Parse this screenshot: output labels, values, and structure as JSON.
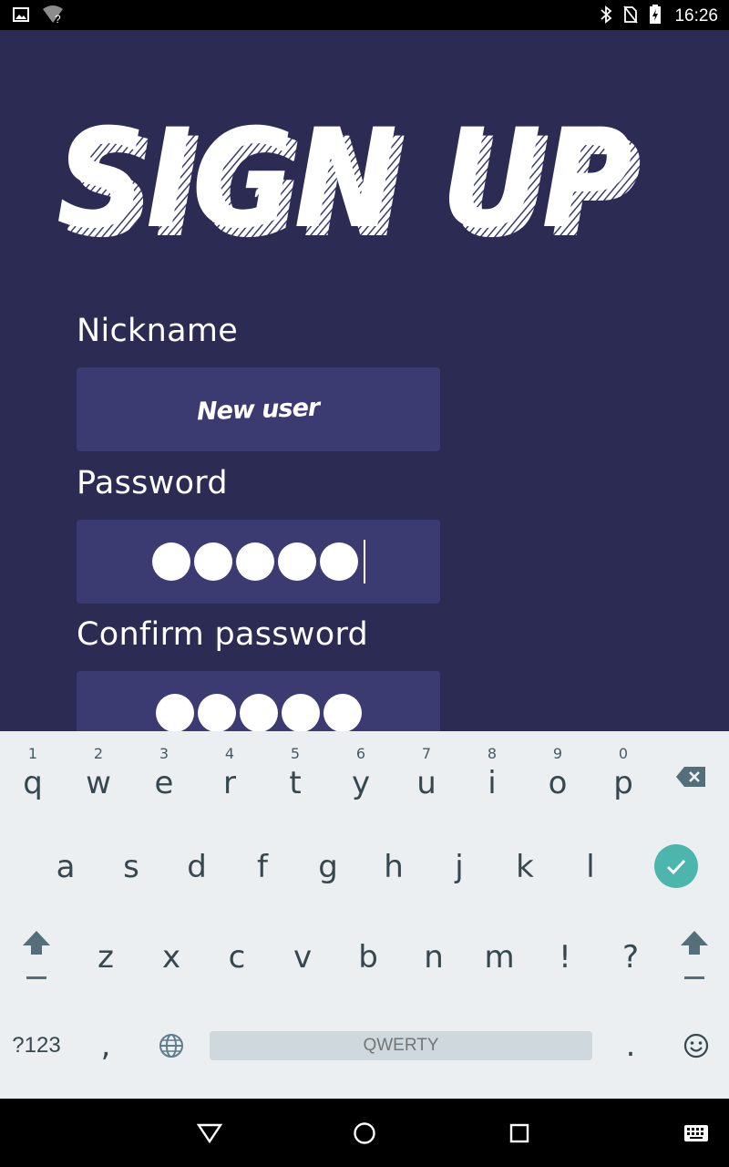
{
  "status_bar": {
    "time": "16:26",
    "left_icons": [
      "image-icon",
      "wifi-unknown-icon"
    ],
    "right_icons": [
      "bluetooth-icon",
      "no-sim-icon",
      "battery-charging-icon"
    ]
  },
  "app": {
    "title": "SIGN UP",
    "nickname_label": "Nickname",
    "nickname_value": "New user",
    "password_label": "Password",
    "password_dot_count": 5,
    "confirm_label": "Confirm password",
    "confirm_dot_count": 5,
    "colors": {
      "background": "#2c2b54",
      "field": "#3b3a71",
      "text": "#ffffff"
    }
  },
  "keyboard": {
    "row1": [
      {
        "key": "q",
        "hint": "1"
      },
      {
        "key": "w",
        "hint": "2"
      },
      {
        "key": "e",
        "hint": "3"
      },
      {
        "key": "r",
        "hint": "4"
      },
      {
        "key": "t",
        "hint": "5"
      },
      {
        "key": "y",
        "hint": "6"
      },
      {
        "key": "u",
        "hint": "7"
      },
      {
        "key": "i",
        "hint": "8"
      },
      {
        "key": "o",
        "hint": "9"
      },
      {
        "key": "p",
        "hint": "0"
      }
    ],
    "row2": [
      "a",
      "s",
      "d",
      "f",
      "g",
      "h",
      "j",
      "k",
      "l"
    ],
    "row3": [
      "z",
      "x",
      "c",
      "v",
      "b",
      "n",
      "m",
      "!",
      "?"
    ],
    "symbols_label": "?123",
    "comma": ",",
    "period": ".",
    "space_label": "QWERTY",
    "accent": "#4db6ac"
  },
  "nav_bar": {
    "buttons": [
      "back-icon",
      "home-icon",
      "recents-icon",
      "keyboard-icon"
    ]
  }
}
